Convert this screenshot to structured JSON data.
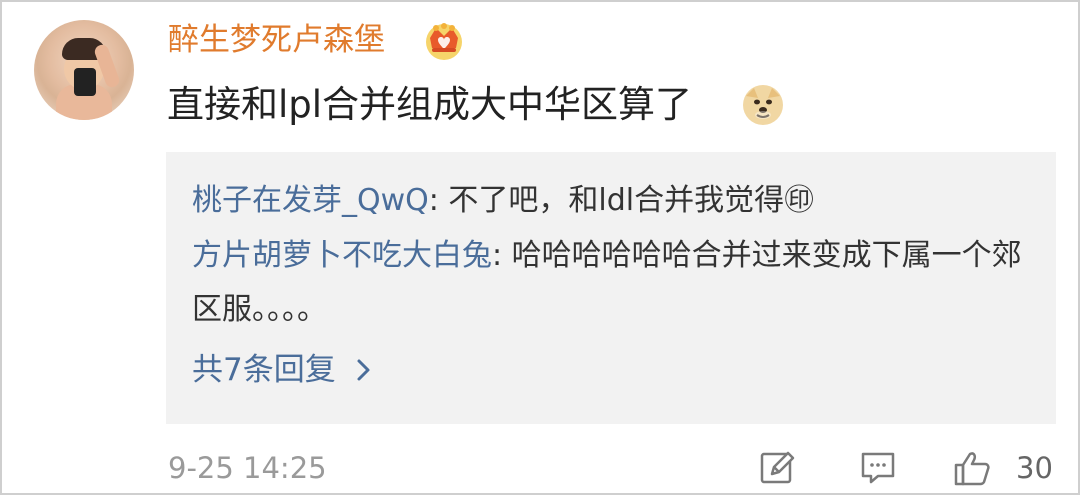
{
  "post": {
    "username": "醉生梦死卢森堡",
    "comment_text": "直接和lpl合并组成大中华区算了",
    "timestamp": "9-25 14:25",
    "like_count": "30"
  },
  "replies": [
    {
      "author": "桃子在发芽_QwQ",
      "separator": ": ",
      "text": "不了吧，和ldl合并我觉得㊞"
    },
    {
      "author": "方片胡萝卜不吃大白兔",
      "separator": ": ",
      "text": "哈哈哈哈哈哈合并过来变成下属一个郊区服。。。。"
    }
  ],
  "more_replies_label": "共7条回复",
  "icons": {
    "crown": "vip-crown-icon",
    "doge": "doge-emoji-icon",
    "chevron": "chevron-right-icon",
    "edit": "edit-icon",
    "comment": "comment-icon",
    "like": "thumbs-up-icon"
  },
  "colors": {
    "username": "#e07b2d",
    "reply_author": "#4a6d9a",
    "reply_bg": "#f2f2f2",
    "meta": "#9a9a9a"
  }
}
